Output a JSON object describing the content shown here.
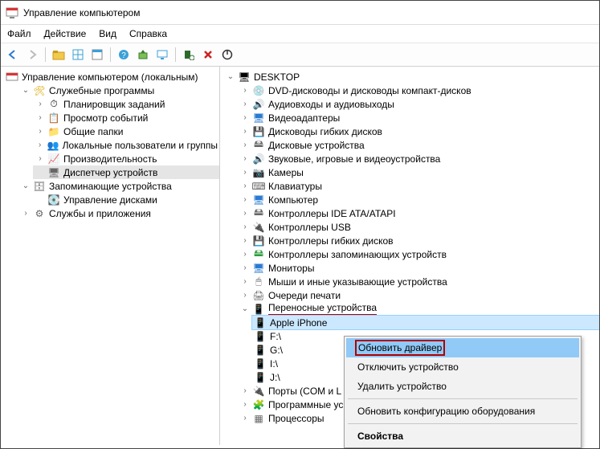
{
  "window": {
    "title": "Управление компьютером"
  },
  "menu": {
    "file": "Файл",
    "action": "Действие",
    "view": "Вид",
    "help": "Справка"
  },
  "left_tree": {
    "root": "Управление компьютером (локальным)",
    "service_tools": "Служебные программы",
    "task_sched": "Планировщик заданий",
    "event_viewer": "Просмотр событий",
    "shared": "Общие папки",
    "local_users": "Локальные пользователи и группы",
    "perf": "Производительность",
    "devmgr": "Диспетчер устройств",
    "storage": "Запоминающие устройства",
    "diskmgr": "Управление дисками",
    "services_apps": "Службы и приложения"
  },
  "right_tree": {
    "root": "DESKTOP",
    "dvd": "DVD-дисководы и дисководы компакт-дисков",
    "audio": "Аудиовходы и аудиовыходы",
    "video": "Видеоадаптеры",
    "floppy": "Дисководы гибких дисков",
    "disk": "Дисковые устройства",
    "sound": "Звуковые, игровые и видеоустройства",
    "camera": "Камеры",
    "keyboard": "Клавиатуры",
    "computer": "Компьютер",
    "ide": "Контроллеры IDE ATA/ATAPI",
    "usb": "Контроллеры USB",
    "floppyctrl": "Контроллеры гибких дисков",
    "storagectrl": "Контроллеры запоминающих устройств",
    "monitor": "Мониторы",
    "mice": "Мыши и иные указывающие устройства",
    "printq": "Очереди печати",
    "portable": "Переносные устройства",
    "portable_children": {
      "iphone": "Apple iPhone",
      "f": "F:\\",
      "g": "G:\\",
      "i": "I:\\",
      "j": "J:\\"
    },
    "ports": "Порты (COM и L",
    "software": "Программные ус",
    "cpu": "Процессоры"
  },
  "context_menu": {
    "update": "Обновить драйвер",
    "disable": "Отключить устройство",
    "uninstall": "Удалить устройство",
    "scan": "Обновить конфигурацию оборудования",
    "props": "Свойства"
  }
}
